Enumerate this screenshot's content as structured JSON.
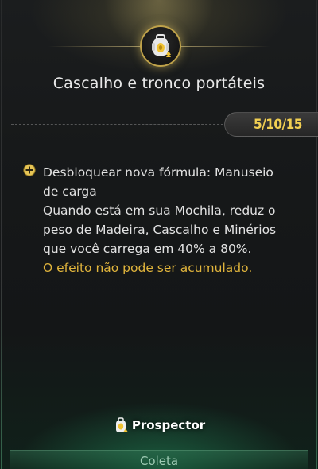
{
  "skill": {
    "title": "Cascalho e tronco portáteis",
    "level": "5/10/15",
    "icon": "backpack-gold-icon"
  },
  "effect": {
    "icon": "plus-circle-icon",
    "lines": [
      "Desbloquear nova fórmula: Manuseio",
      "de carga",
      "Quando está em sua Mochila, reduz o",
      "peso de Madeira, Cascalho e Minérios",
      "que você carrega em 40% a 80%."
    ],
    "note": "O efeito não pode ser acumulado."
  },
  "class": {
    "name": "Prospector",
    "icon": "prospector-backpack-icon"
  },
  "category": {
    "label": "Coleta"
  },
  "colors": {
    "accent_gold": "#f1cf52",
    "note_gold": "#e0b43c",
    "category_green": "#9fcbb4"
  }
}
